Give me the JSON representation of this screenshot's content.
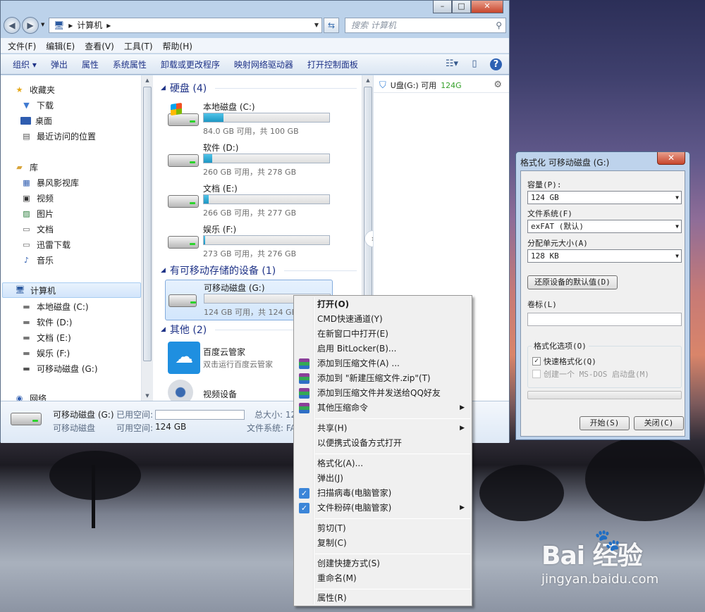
{
  "explorer": {
    "breadcrumb": [
      "计算机"
    ],
    "search_placeholder": "搜索 计算机",
    "menu": [
      "文件(F)",
      "编辑(E)",
      "查看(V)",
      "工具(T)",
      "帮助(H)"
    ],
    "toolbar": [
      "组织 ▾",
      "弹出",
      "属性",
      "系统属性",
      "卸载或更改程序",
      "映射网络驱动器",
      "打开控制面板"
    ],
    "nav": {
      "favorites": {
        "label": "收藏夹",
        "items": [
          "下载",
          "桌面",
          "最近访问的位置"
        ]
      },
      "libraries": {
        "label": "库",
        "items": [
          "暴风影视库",
          "视频",
          "图片",
          "文档",
          "迅雷下载",
          "音乐"
        ]
      },
      "computer": {
        "label": "计算机",
        "items": [
          "本地磁盘 (C:)",
          "软件 (D:)",
          "文档 (E:)",
          "娱乐 (F:)",
          "可移动磁盘 (G:)"
        ]
      },
      "network": {
        "label": "网络"
      }
    },
    "groups": {
      "hard_disks": "硬盘 (4)",
      "removable": "有可移动存储的设备 (1)",
      "other": "其他 (2)"
    },
    "drives": [
      {
        "name": "本地磁盘 (C:)",
        "size": "84.0 GB 可用，共 100 GB",
        "used_fraction": 0.16
      },
      {
        "name": "软件 (D:)",
        "size": "260 GB 可用，共 278 GB",
        "used_fraction": 0.065
      },
      {
        "name": "文档 (E:)",
        "size": "266 GB 可用，共 277 GB",
        "used_fraction": 0.04
      },
      {
        "name": "娱乐 (F:)",
        "size": "273 GB 可用，共 276 GB",
        "used_fraction": 0.011
      }
    ],
    "removable": {
      "name": "可移动磁盘 (G:)",
      "size": "124 GB 可用，共 124 GB",
      "used_fraction": 0.0
    },
    "other": [
      {
        "name": "百度云管家",
        "desc": "双击运行百度云管家"
      },
      {
        "name": "视频设备",
        "desc": ""
      }
    ],
    "preview": {
      "label": "U盘(G:) 可用",
      "free": "124G"
    },
    "details": {
      "name": "可移动磁盘 (G:)",
      "type": "可移动磁盘",
      "used_label": "已用空间:",
      "free_label": "可用空间:",
      "free_value": "124 GB",
      "total_label": "总大小: 12",
      "fs_label": "文件系统: FA"
    }
  },
  "format_dialog": {
    "title": "格式化 可移动磁盘 (G:)",
    "capacity_label": "容量(P):",
    "capacity_value": "124 GB",
    "fs_label": "文件系统(F)",
    "fs_value": "exFAT (默认)",
    "alloc_label": "分配单元大小(A)",
    "alloc_value": "128 KB",
    "restore_button": "还原设备的默认值(D)",
    "volume_label": "卷标(L)",
    "volume_value": "",
    "options_label": "格式化选项(O)",
    "quick_format": "快速格式化(Q)",
    "quick_checked": true,
    "msdos": "创建一个 MS-DOS 启动盘(M)",
    "start_button": "开始(S)",
    "close_button": "关闭(C)"
  },
  "context_menu": {
    "items": [
      {
        "label": "打开(O)",
        "bold": true
      },
      {
        "label": "CMD快速通道(Y)"
      },
      {
        "label": "在新窗口中打开(E)"
      },
      {
        "label": "启用 BitLocker(B)..."
      },
      {
        "label": "添加到压缩文件(A) ...",
        "icon": "winrar-icon"
      },
      {
        "label": "添加到 \"新建压缩文件.zip\"(T)",
        "icon": "winrar-icon"
      },
      {
        "label": "添加到压缩文件并发送给QQ好友",
        "icon": "winrar-icon"
      },
      {
        "label": "其他压缩命令",
        "icon": "winrar-icon",
        "submenu": true
      },
      {
        "label": "共享(H)",
        "submenu": true
      },
      {
        "label": "以便携式设备方式打开"
      },
      {
        "label": "格式化(A)..."
      },
      {
        "label": "弹出(J)"
      },
      {
        "label": "扫描病毒(电脑管家)",
        "icon": "shield-icon"
      },
      {
        "label": "文件粉碎(电脑管家)",
        "icon": "shield-icon",
        "submenu": true
      },
      {
        "label": "剪切(T)"
      },
      {
        "label": "复制(C)"
      },
      {
        "label": "创建快捷方式(S)"
      },
      {
        "label": "重命名(M)"
      },
      {
        "label": "属性(R)"
      }
    ]
  },
  "watermark": {
    "brand": "Bai  经验",
    "url": "jingyan.baidu.com"
  }
}
